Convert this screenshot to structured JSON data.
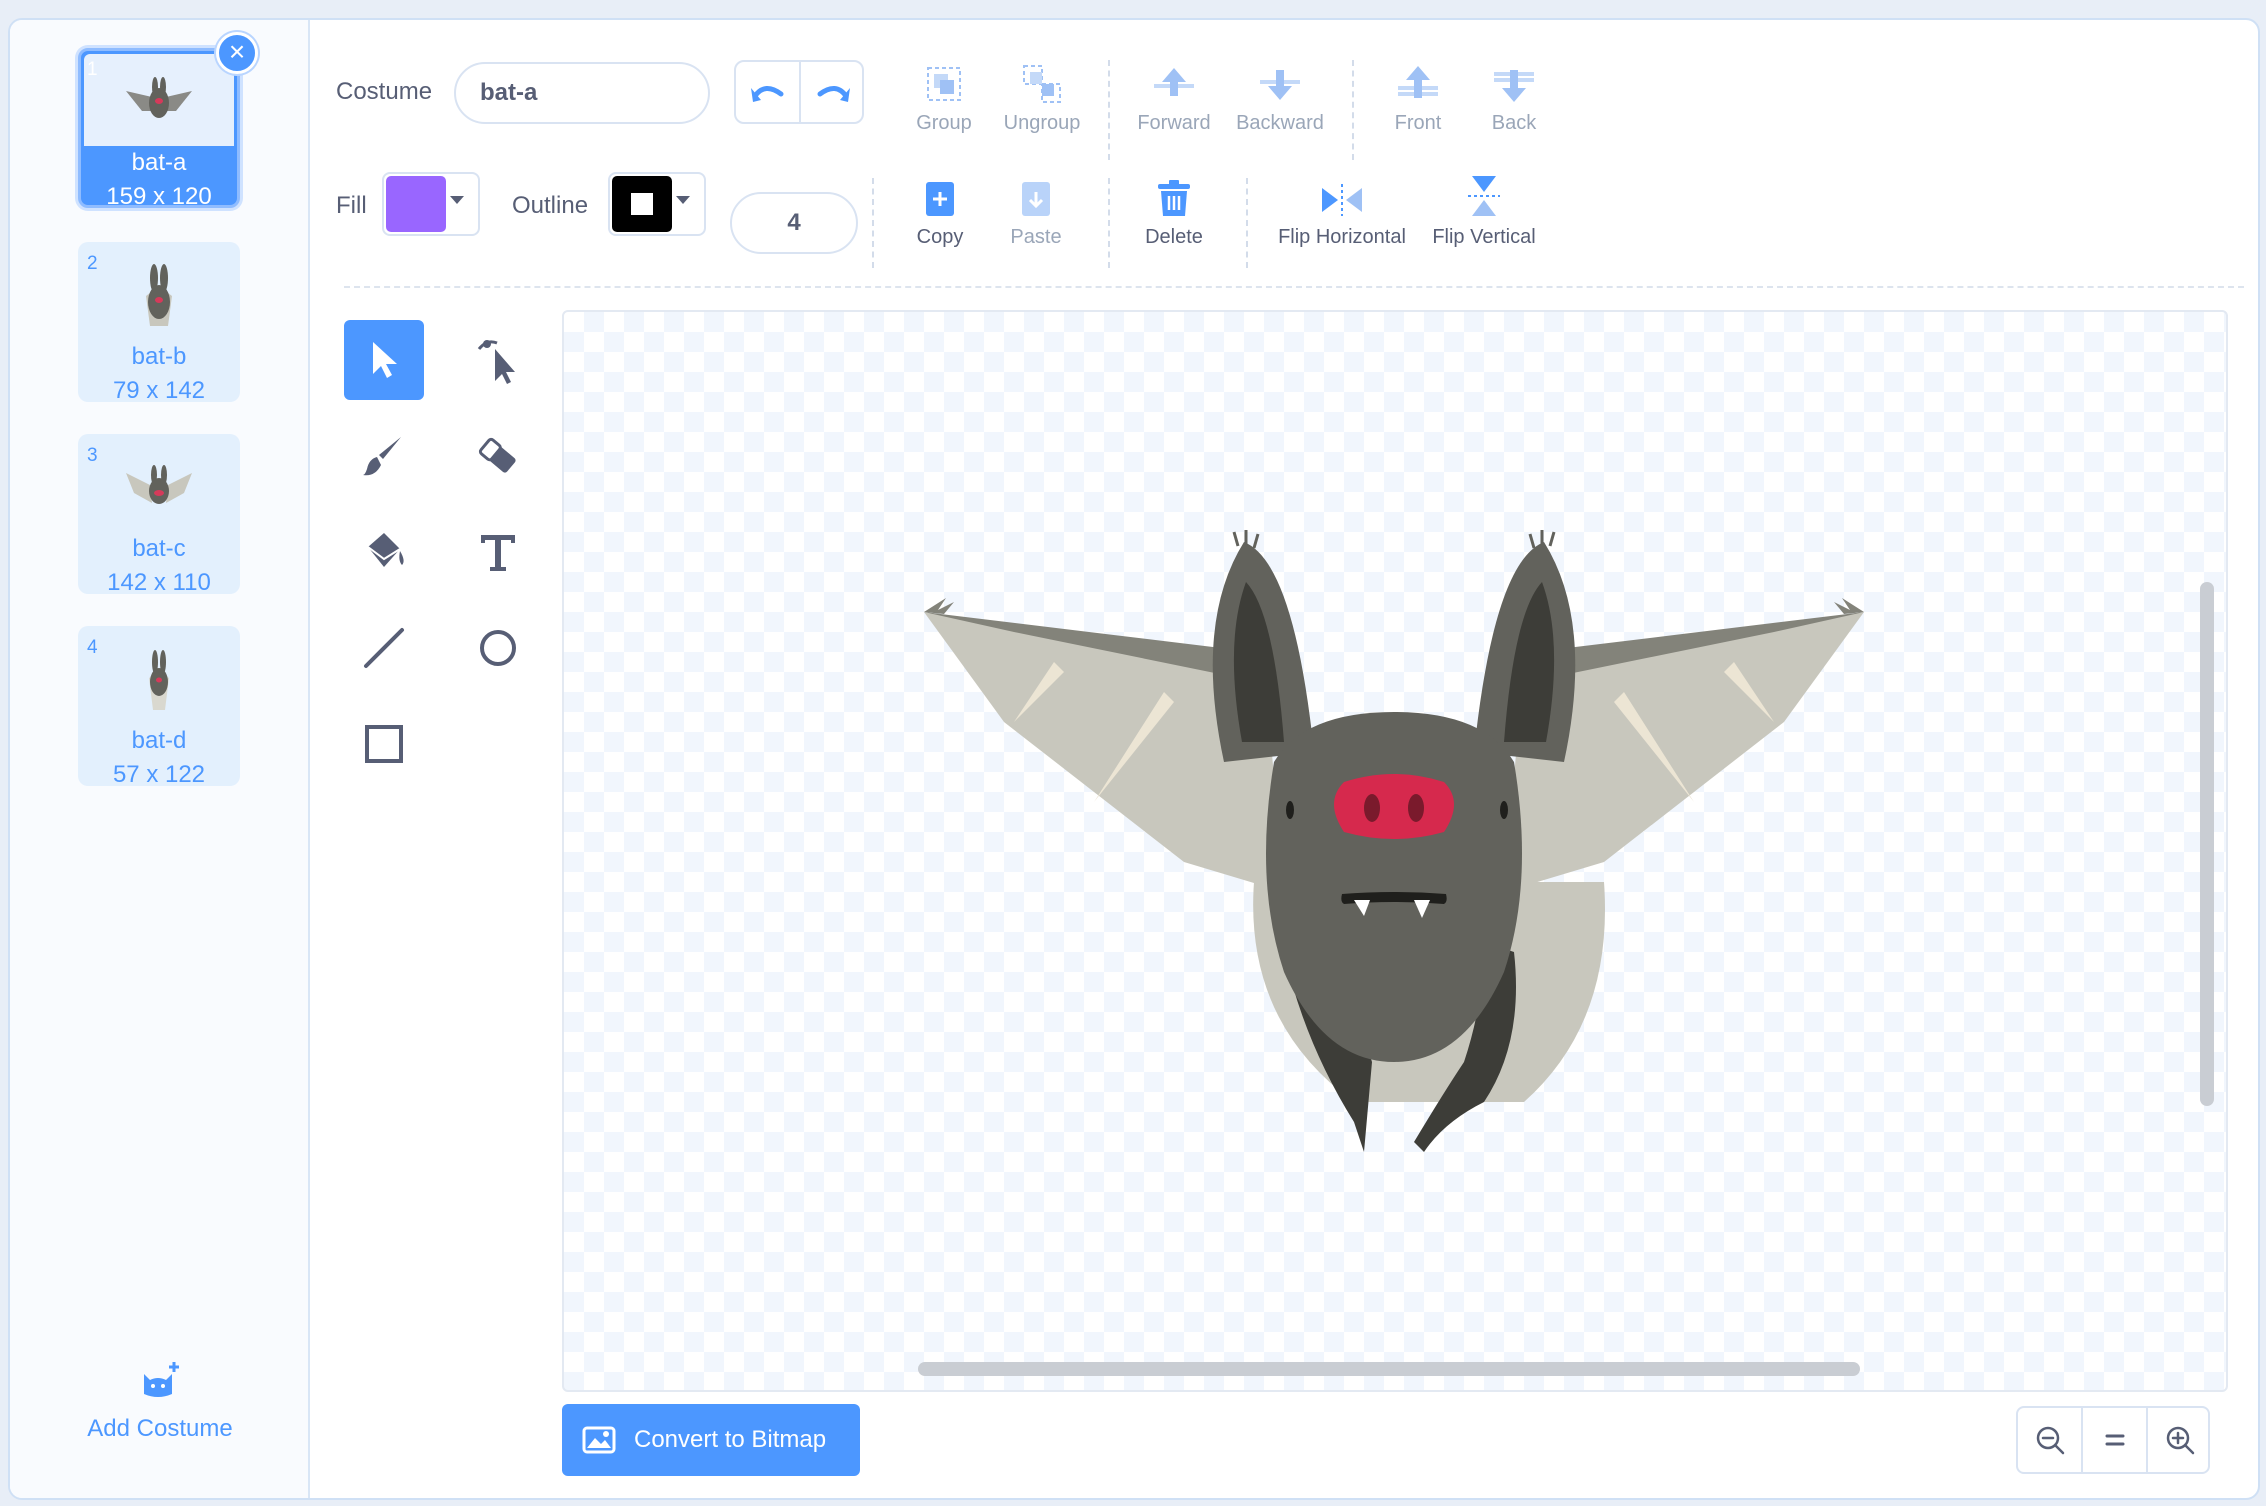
{
  "sidebar": {
    "costumes": [
      {
        "num": "1",
        "name": "bat-a",
        "size": "159 x 120",
        "selected": true
      },
      {
        "num": "2",
        "name": "bat-b",
        "size": "79 x 142",
        "selected": false
      },
      {
        "num": "3",
        "name": "bat-c",
        "size": "142 x 110",
        "selected": false
      },
      {
        "num": "4",
        "name": "bat-d",
        "size": "57 x 122",
        "selected": false
      }
    ],
    "add_costume_label": "Add Costume"
  },
  "toolbar": {
    "costume_label": "Costume",
    "costume_name": "bat-a",
    "fill_label": "Fill",
    "outline_label": "Outline",
    "stroke_width": "4",
    "group": "Group",
    "ungroup": "Ungroup",
    "forward": "Forward",
    "backward": "Backward",
    "front": "Front",
    "back": "Back",
    "copy": "Copy",
    "paste": "Paste",
    "delete": "Delete",
    "flip_horizontal": "Flip Horizontal",
    "flip_vertical": "Flip Vertical"
  },
  "colors": {
    "accent": "#4c97ff",
    "fill": "#9966ff",
    "outline": "#000000"
  },
  "canvas": {
    "convert_label": "Convert to Bitmap"
  }
}
